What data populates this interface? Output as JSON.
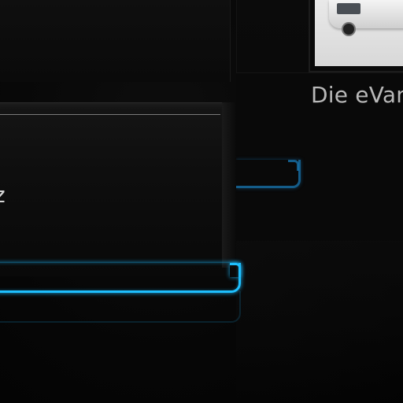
{
  "tiles": [
    {
      "id": "selected",
      "label": "z",
      "selected": true
    },
    {
      "id": "evan",
      "label": "Die eVan",
      "selected": false
    }
  ],
  "colors": {
    "accent_glow": "#1ec0ff",
    "background": "#050505",
    "label_text": "#b8b8b8"
  },
  "icons": {
    "thumbnail": "van-image"
  }
}
